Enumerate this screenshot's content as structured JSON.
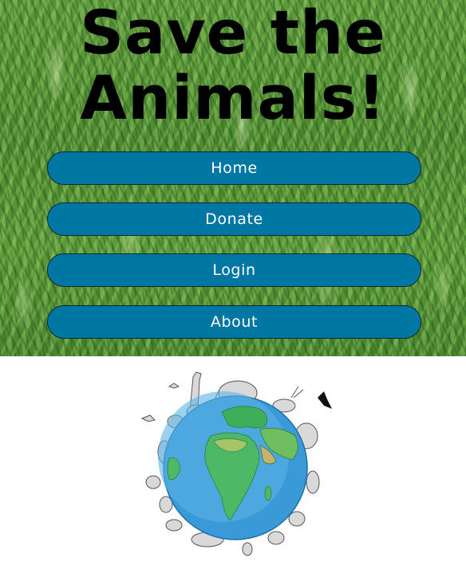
{
  "hero": {
    "title_line1": "Save the",
    "title_line2": "Animals!",
    "background": "grass"
  },
  "nav": {
    "items": [
      {
        "label": "Home"
      },
      {
        "label": "Donate"
      },
      {
        "label": "Login"
      },
      {
        "label": "About"
      }
    ],
    "button_color": "#0076a3"
  },
  "illustration": {
    "icon": "earth-globe-with-animals-icon"
  }
}
